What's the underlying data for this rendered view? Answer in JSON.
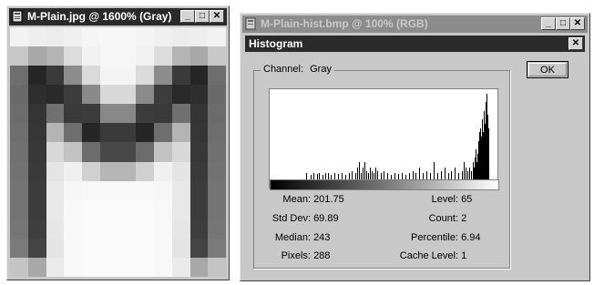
{
  "left_window": {
    "title": "M-Plain.jpg @ 1600% (Gray)",
    "pixel_grid": {
      "cols": 12,
      "rows": 13,
      "shades": [
        "#f2f2f2",
        "#eeeeee",
        "#ececec",
        "#f0f0f0",
        "#f5f5f5",
        "#f6f6f6",
        "#f6f6f6",
        "#f4f4f4",
        "#f0f0f0",
        "#ececec",
        "#eeeeee",
        "#f2f2f2",
        "#c8c8c8",
        "#a8a8a8",
        "#b4b4b4",
        "#dcdcdc",
        "#f2f2f2",
        "#f6f6f6",
        "#f6f6f6",
        "#f2f2f2",
        "#dcdcdc",
        "#b4b4b4",
        "#a8a8a8",
        "#c8c8c8",
        "#6e6e6e",
        "#262626",
        "#3a3a3a",
        "#8c8c8c",
        "#dadada",
        "#f4f4f4",
        "#f4f4f4",
        "#dadada",
        "#8c8c8c",
        "#3a3a3a",
        "#262626",
        "#6e6e6e",
        "#6a6a6a",
        "#2e2e2e",
        "#2a2a2a",
        "#3c3c3c",
        "#8a8a8a",
        "#d8d8d8",
        "#d8d8d8",
        "#8a8a8a",
        "#3c3c3c",
        "#2a2a2a",
        "#2e2e2e",
        "#6a6a6a",
        "#6c6c6c",
        "#343434",
        "#707070",
        "#3a3a3a",
        "#3c3c3c",
        "#888888",
        "#888888",
        "#3c3c3c",
        "#3a3a3a",
        "#707070",
        "#343434",
        "#6c6c6c",
        "#6e6e6e",
        "#363636",
        "#b4b4b4",
        "#6e6e6e",
        "#262626",
        "#3a3a3a",
        "#3a3a3a",
        "#262626",
        "#6e6e6e",
        "#b4b4b4",
        "#363636",
        "#6e6e6e",
        "#707070",
        "#383838",
        "#d8d8d8",
        "#c2c2c2",
        "#6c6c6c",
        "#484848",
        "#484848",
        "#6c6c6c",
        "#c2c2c2",
        "#d8d8d8",
        "#383838",
        "#707070",
        "#727272",
        "#3a3a3a",
        "#e4e4e4",
        "#f0f0f0",
        "#d0d0d0",
        "#b6b6b6",
        "#b6b6b6",
        "#d0d0d0",
        "#f0f0f0",
        "#e4e4e4",
        "#3a3a3a",
        "#727272",
        "#747474",
        "#3c3c3c",
        "#e8e8e8",
        "#f6f6f6",
        "#f8f8f8",
        "#f8f8f8",
        "#f8f8f8",
        "#f8f8f8",
        "#f6f6f6",
        "#e8e8e8",
        "#3c3c3c",
        "#747474",
        "#747474",
        "#3c3c3c",
        "#e8e8e8",
        "#f8f8f8",
        "#fafafa",
        "#fafafa",
        "#fafafa",
        "#fafafa",
        "#f8f8f8",
        "#e8e8e8",
        "#3c3c3c",
        "#747474",
        "#767676",
        "#3e3e3e",
        "#e6e6e6",
        "#f8f8f8",
        "#fafafa",
        "#fafafa",
        "#fafafa",
        "#fafafa",
        "#f8f8f8",
        "#e6e6e6",
        "#3e3e3e",
        "#767676",
        "#7a7a7a",
        "#444444",
        "#e4e4e4",
        "#f8f8f8",
        "#fafafa",
        "#fafafa",
        "#fafafa",
        "#fafafa",
        "#f8f8f8",
        "#e4e4e4",
        "#444444",
        "#7a7a7a",
        "#c4c4c4",
        "#a8a8a8",
        "#eaeaea",
        "#f8f8f8",
        "#fafafa",
        "#fafafa",
        "#fafafa",
        "#fafafa",
        "#f8f8f8",
        "#eaeaea",
        "#a8a8a8",
        "#c4c4c4"
      ]
    }
  },
  "right_window": {
    "title": "M-Plain-hist.bmp @ 100% (RGB)"
  },
  "histogram_dialog": {
    "title": "Histogram",
    "channel_label": "Channel:",
    "channel_value": "Gray",
    "ok_label": "OK",
    "stats_left": [
      {
        "label": "Mean:",
        "value": "201.75"
      },
      {
        "label": "Std Dev:",
        "value": "69.89"
      },
      {
        "label": "Median:",
        "value": "243"
      },
      {
        "label": "Pixels:",
        "value": "288"
      }
    ],
    "stats_right": [
      {
        "label": "Level:",
        "value": "65"
      },
      {
        "label": "Count:",
        "value": "2"
      },
      {
        "label": "Percentile:",
        "value": "6.94"
      },
      {
        "label": "Cache Level:",
        "value": "1"
      }
    ]
  },
  "histogram_bars": [
    {
      "level": 40,
      "h": 0.07
    },
    {
      "level": 45,
      "h": 0.05
    },
    {
      "level": 48,
      "h": 0.07
    },
    {
      "level": 52,
      "h": 0.06
    },
    {
      "level": 55,
      "h": 0.07
    },
    {
      "level": 59,
      "h": 0.05
    },
    {
      "level": 62,
      "h": 0.07
    },
    {
      "level": 65,
      "h": 0.07
    },
    {
      "level": 68,
      "h": 0.05
    },
    {
      "level": 72,
      "h": 0.07
    },
    {
      "level": 76,
      "h": 0.06
    },
    {
      "level": 80,
      "h": 0.07
    },
    {
      "level": 84,
      "h": 0.05
    },
    {
      "level": 88,
      "h": 0.07
    },
    {
      "level": 92,
      "h": 0.1
    },
    {
      "level": 96,
      "h": 0.07
    },
    {
      "level": 98,
      "h": 0.14
    },
    {
      "level": 100,
      "h": 0.2
    },
    {
      "level": 102,
      "h": 0.07
    },
    {
      "level": 104,
      "h": 0.14
    },
    {
      "level": 106,
      "h": 0.2
    },
    {
      "level": 108,
      "h": 0.1
    },
    {
      "level": 110,
      "h": 0.07
    },
    {
      "level": 112,
      "h": 0.14
    },
    {
      "level": 114,
      "h": 0.1
    },
    {
      "level": 116,
      "h": 0.07
    },
    {
      "level": 118,
      "h": 0.14
    },
    {
      "level": 120,
      "h": 0.1
    },
    {
      "level": 124,
      "h": 0.07
    },
    {
      "level": 128,
      "h": 0.1
    },
    {
      "level": 132,
      "h": 0.07
    },
    {
      "level": 136,
      "h": 0.05
    },
    {
      "level": 140,
      "h": 0.07
    },
    {
      "level": 144,
      "h": 0.06
    },
    {
      "level": 148,
      "h": 0.07
    },
    {
      "level": 152,
      "h": 0.05
    },
    {
      "level": 156,
      "h": 0.07
    },
    {
      "level": 160,
      "h": 0.1
    },
    {
      "level": 164,
      "h": 0.07
    },
    {
      "level": 168,
      "h": 0.14
    },
    {
      "level": 172,
      "h": 0.07
    },
    {
      "level": 176,
      "h": 0.1
    },
    {
      "level": 180,
      "h": 0.07
    },
    {
      "level": 184,
      "h": 0.2
    },
    {
      "level": 188,
      "h": 0.07
    },
    {
      "level": 192,
      "h": 0.1
    },
    {
      "level": 196,
      "h": 0.14
    },
    {
      "level": 200,
      "h": 0.07
    },
    {
      "level": 204,
      "h": 0.1
    },
    {
      "level": 208,
      "h": 0.14
    },
    {
      "level": 212,
      "h": 0.07
    },
    {
      "level": 216,
      "h": 0.1
    },
    {
      "level": 218,
      "h": 0.2
    },
    {
      "level": 220,
      "h": 0.14
    },
    {
      "level": 222,
      "h": 0.1
    },
    {
      "level": 224,
      "h": 0.14
    },
    {
      "level": 226,
      "h": 0.1
    },
    {
      "level": 228,
      "h": 0.2
    },
    {
      "level": 229,
      "h": 0.14
    },
    {
      "level": 230,
      "h": 0.25
    },
    {
      "level": 231,
      "h": 0.35
    },
    {
      "level": 232,
      "h": 0.2
    },
    {
      "level": 233,
      "h": 0.3
    },
    {
      "level": 234,
      "h": 0.45
    },
    {
      "level": 235,
      "h": 0.55
    },
    {
      "level": 236,
      "h": 0.4
    },
    {
      "level": 237,
      "h": 0.6
    },
    {
      "level": 238,
      "h": 0.5
    },
    {
      "level": 239,
      "h": 0.7
    },
    {
      "level": 240,
      "h": 0.55
    },
    {
      "level": 241,
      "h": 0.8
    },
    {
      "level": 242,
      "h": 0.65
    },
    {
      "level": 243,
      "h": 0.9
    },
    {
      "level": 244,
      "h": 1.0
    },
    {
      "level": 245,
      "h": 0.75
    },
    {
      "level": 246,
      "h": 0.6
    }
  ]
}
